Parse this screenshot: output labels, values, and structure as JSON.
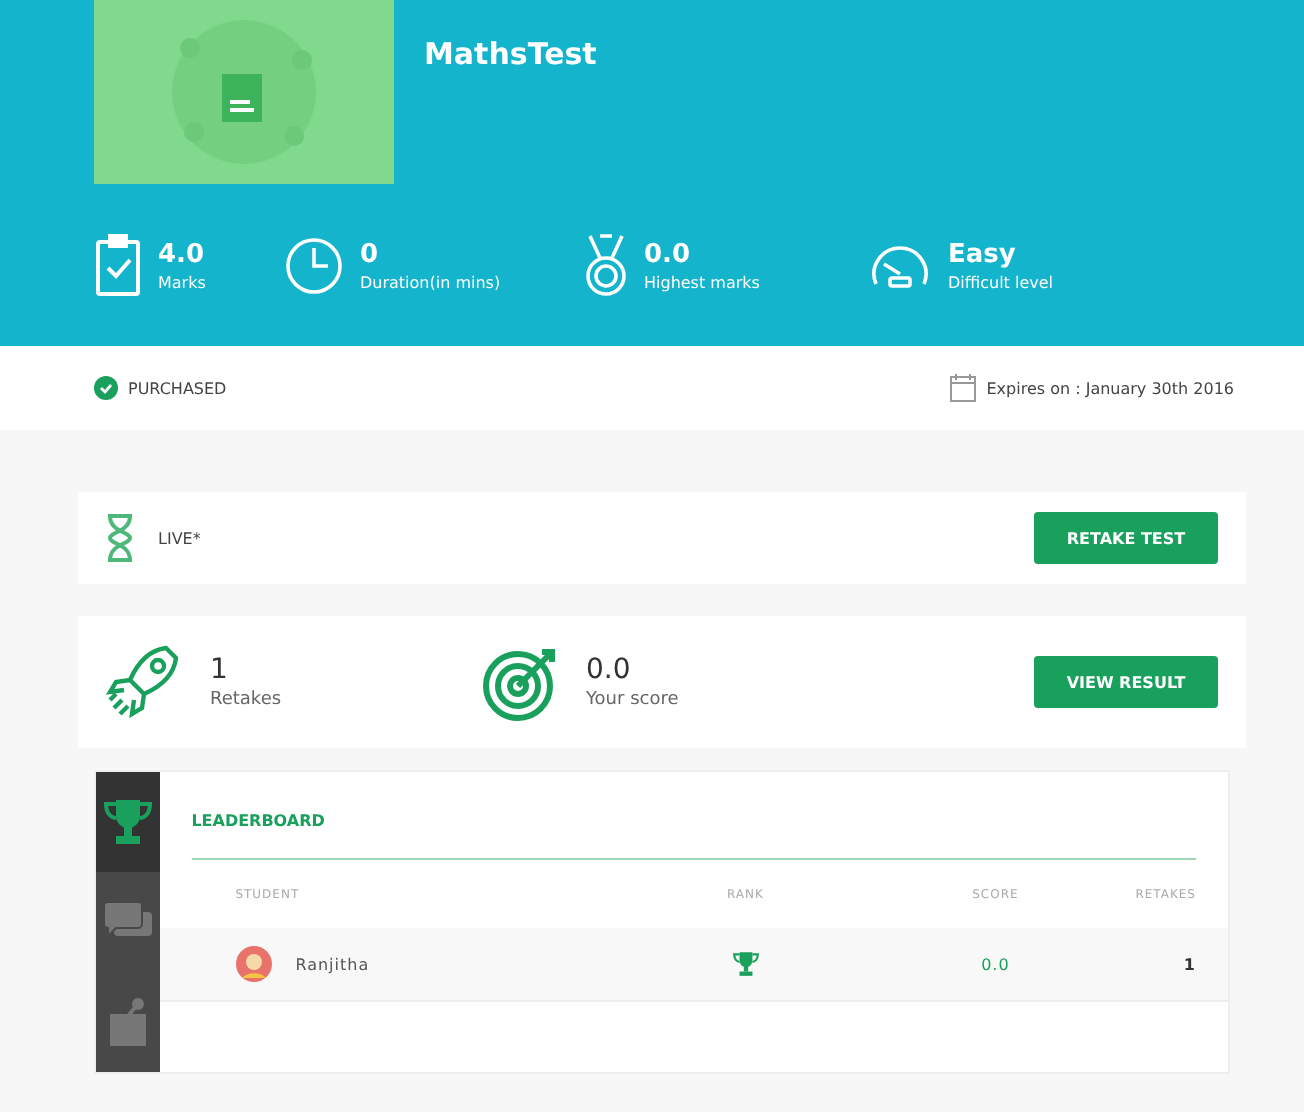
{
  "test": {
    "title": "MathsTest"
  },
  "stats": [
    {
      "kind": "marks",
      "value": "4.0",
      "label": "Marks"
    },
    {
      "kind": "duration",
      "value": "0",
      "label": "Duration(in mins)"
    },
    {
      "kind": "highest",
      "value": "0.0",
      "label": "Highest marks"
    },
    {
      "kind": "difficulty",
      "value": "Easy",
      "label": "Difficult level"
    }
  ],
  "status": {
    "purchased": "PURCHASED",
    "expires": "Expires on : January 30th 2016"
  },
  "live": {
    "label": "LIVE*",
    "button": "RETAKE TEST"
  },
  "results": {
    "retakes_value": "1",
    "retakes_label": "Retakes",
    "score_value": "0.0",
    "score_label": "Your score",
    "button": "VIEW RESULT"
  },
  "leaderboard": {
    "tabs": [
      {
        "kind": "trophy",
        "selected": true
      },
      {
        "kind": "chat",
        "selected": false
      },
      {
        "kind": "board",
        "selected": false
      }
    ],
    "heading": "LEADERBOARD",
    "columns": [
      "STUDENT",
      "RANK",
      "SCORE",
      "RETAKES"
    ],
    "rows": [
      {
        "student": "Ranjitha",
        "score": "0.0",
        "retakes": "1"
      }
    ]
  }
}
